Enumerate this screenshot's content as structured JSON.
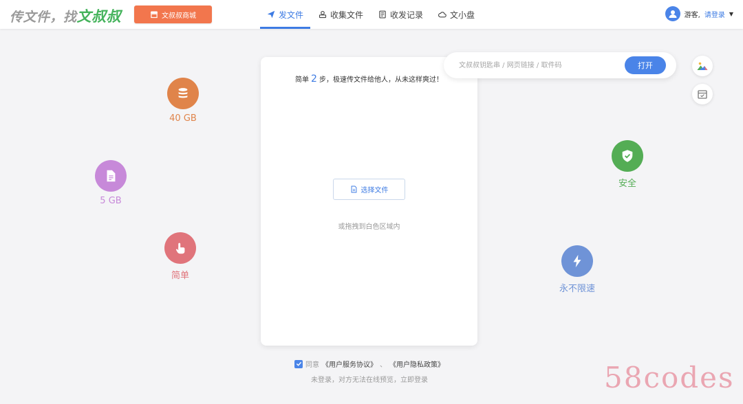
{
  "header": {
    "logo_prefix": "传文件，找",
    "logo_brand": "文叔叔",
    "mall_button": "文叔叔商城",
    "nav": [
      {
        "label": "发文件",
        "active": true
      },
      {
        "label": "收集文件",
        "active": false
      },
      {
        "label": "收发记录",
        "active": false
      },
      {
        "label": "文小盘",
        "active": false
      }
    ],
    "user": {
      "guest_label": "游客,",
      "login_label": "请登录",
      "caret": "▼"
    }
  },
  "features": [
    {
      "label": "40 GB",
      "icon": "database-icon",
      "color": "#e0844a"
    },
    {
      "label": "5 GB",
      "icon": "document-icon",
      "color": "#c789d9"
    },
    {
      "label": "简单",
      "icon": "tap-hand-icon",
      "color": "#e0747b"
    },
    {
      "label": "安全",
      "icon": "shield-check-icon",
      "color": "#54ad55"
    },
    {
      "label": "永不限速",
      "icon": "lightning-icon",
      "color": "#6f93d7"
    }
  ],
  "card": {
    "tip_prefix": "简单",
    "tip_number": "2",
    "tip_suffix": "步，极速传文件给他人，从未这样爽过！",
    "select_button": "选择文件",
    "drag_tip": "或拖拽到白色区域内"
  },
  "search": {
    "placeholder": "文叔叔钥匙串 / 网页链接 / 取件码",
    "value": "",
    "open_button": "打开"
  },
  "agreement": {
    "checked": true,
    "agree_text": "同意",
    "service_link": "《用户服务协议》",
    "separator": "、",
    "privacy_link": "《用户隐私政策》",
    "note": "未登录，对方无法在线预览，立即登录"
  },
  "watermark": "58codes",
  "colors": {
    "accent": "#3d7be3",
    "mall_button": "#f2764d",
    "brand_green": "#45b35c",
    "background": "#f4f4f6"
  }
}
